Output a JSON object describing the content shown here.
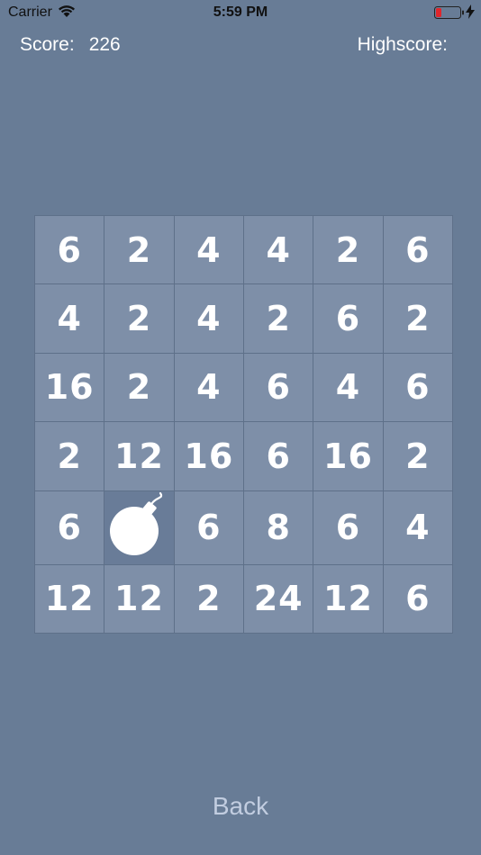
{
  "status_bar": {
    "carrier": "Carrier",
    "time": "5:59 PM",
    "icons": [
      "wifi-icon",
      "battery-icon",
      "charging-bolt-icon"
    ]
  },
  "header": {
    "score_label": "Score:",
    "score_value": "226",
    "highscore_label": "Highscore:"
  },
  "board": {
    "rows": 6,
    "cols": 6,
    "cells": [
      [
        "6",
        "2",
        "4",
        "4",
        "2",
        "6"
      ],
      [
        "4",
        "2",
        "4",
        "2",
        "6",
        "2"
      ],
      [
        "16",
        "2",
        "4",
        "6",
        "4",
        "6"
      ],
      [
        "2",
        "12",
        "16",
        "6",
        "16",
        "2"
      ],
      [
        "6",
        "bomb",
        "6",
        "8",
        "6",
        "4"
      ],
      [
        "12",
        "12",
        "2",
        "24",
        "12",
        "6"
      ]
    ]
  },
  "footer": {
    "back_label": "Back"
  },
  "colors": {
    "background": "#687c96",
    "tile": "#7e8fa8",
    "bomb_tile": "#697c98",
    "back_text": "#c2cde0"
  }
}
